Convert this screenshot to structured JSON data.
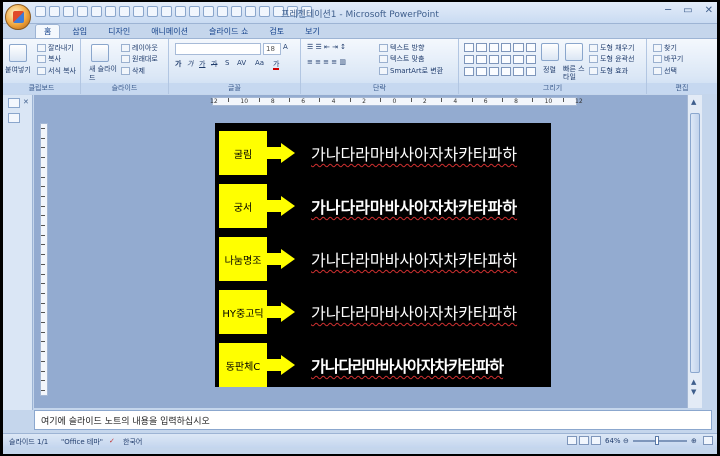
{
  "window": {
    "title": "프레젠테이션1 - Microsoft PowerPoint",
    "controls": [
      "─",
      "▭",
      "✕"
    ]
  },
  "tabs": [
    "홈",
    "삽입",
    "디자인",
    "애니메이션",
    "슬라이드 쇼",
    "검토",
    "보기"
  ],
  "ribbon": {
    "clipboard": {
      "label": "클립보드",
      "paste": "붙여넣기",
      "cut": "잘라내기",
      "copy": "복사",
      "format_painter": "서식 복사"
    },
    "slides": {
      "label": "슬라이드",
      "new_slide": "새 슬라이드",
      "layout": "레이아웃",
      "reset": "원래대로",
      "delete": "삭제"
    },
    "font": {
      "label": "글꼴",
      "size": "18"
    },
    "paragraph": {
      "label": "단락",
      "text_direction": "텍스트 방향",
      "align_text": "텍스트 맞춤",
      "smartart": "SmartArt로 변환"
    },
    "drawing": {
      "label": "그리기",
      "arrange": "정렬",
      "quick_styles": "빠른 스타일",
      "shape_fill": "도형 채우기",
      "shape_outline": "도형 윤곽선",
      "shape_effects": "도형 효과"
    },
    "editing": {
      "label": "편집",
      "find": "찾기",
      "replace": "바꾸기",
      "select": "선택"
    }
  },
  "ruler": {
    "numbers": [
      "12",
      "10",
      "8",
      "6",
      "4",
      "2",
      "0",
      "2",
      "4",
      "6",
      "8",
      "10",
      "12"
    ]
  },
  "slide": {
    "rows": [
      {
        "font_label": "굴림",
        "sample": "가나다라마바사아자차카타파하"
      },
      {
        "font_label": "궁서",
        "sample": "가나다라마바사아자차카타파하"
      },
      {
        "font_label": "나눔명조",
        "sample": "가나다라마바사아자차카타파하"
      },
      {
        "font_label": "HY중고딕",
        "sample": "가나다라마바사아자차카타파하"
      },
      {
        "font_label": "동판체C",
        "sample": "가나다라마바사아자차카타파하"
      }
    ]
  },
  "notes": {
    "placeholder": "여기에 슬라이드 노트의 내용을 입력하십시오"
  },
  "status": {
    "slide": "슬라이드 1/1",
    "theme": "\"Office 테마\"",
    "language": "한국어",
    "zoom": "64%"
  }
}
